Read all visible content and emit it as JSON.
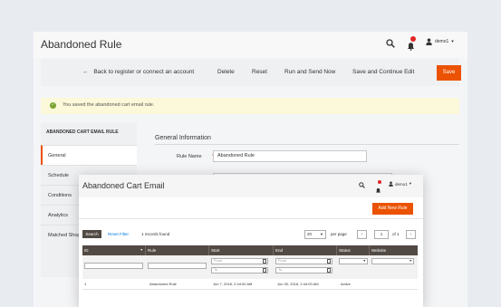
{
  "back": {
    "title": "Abandoned Rule",
    "user": "demo1",
    "toolbar": {
      "back_label": "Back to register or connect an account",
      "delete_label": "Delete",
      "reset_label": "Reset",
      "run_send_label": "Run and Send Now",
      "save_continue_label": "Save and Continue Edit",
      "save_label": "Save"
    },
    "message": "You saved the abandoned cart email rule.",
    "sidebar": {
      "heading": "ABANDONED CART EMAIL RULE",
      "items": [
        {
          "label": "General",
          "active": true
        },
        {
          "label": "Schedule"
        },
        {
          "label": "Conditions"
        },
        {
          "label": "Analytics"
        },
        {
          "label": "Matched Shop"
        }
      ]
    },
    "form": {
      "section_title": "General Information",
      "rule_name_label": "Rule Name",
      "required_mark": "*",
      "rule_name_value": "Abandoned Rule"
    }
  },
  "front": {
    "title": "Abandoned Cart Email",
    "user": "demo1",
    "add_button": "Add New Rule",
    "search_button": "Search",
    "reset_filter": "Reset Filter",
    "records_found": "1 records found",
    "per_page_value": "20",
    "per_page_label": "per page",
    "page_prev": "‹",
    "page_next": "›",
    "page_current": "1",
    "page_of": "of 1",
    "columns": [
      "ID",
      "Rule",
      "Start",
      "End",
      "Status",
      "Website"
    ],
    "filters": {
      "from_placeholder": "From",
      "to_placeholder": "To"
    },
    "rows": [
      {
        "id": "1",
        "rule": "Abandoned Rule",
        "start": "Jun 7, 2018, 2:44:00 AM",
        "end": "Jun 30, 2018, 2:44:00 AM",
        "status": "Active",
        "website": ""
      }
    ]
  },
  "colors": {
    "accent": "#eb5202",
    "table_header": "#514943",
    "success_bg": "#fbf9d9",
    "link": "#007bdb"
  }
}
